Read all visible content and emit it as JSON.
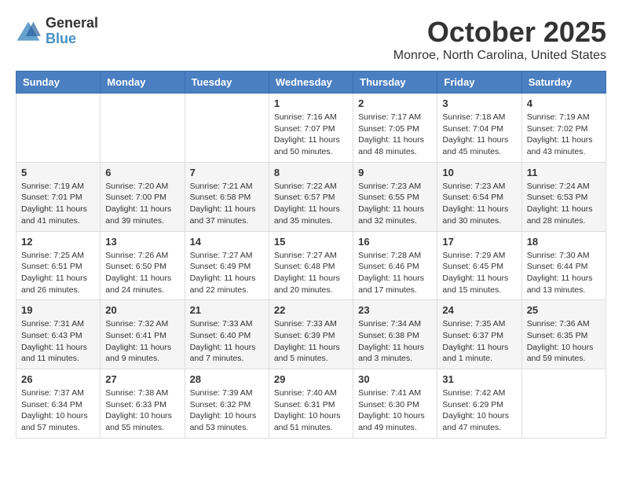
{
  "header": {
    "logo_general": "General",
    "logo_blue": "Blue",
    "month_title": "October 2025",
    "location": "Monroe, North Carolina, United States"
  },
  "days_of_week": [
    "Sunday",
    "Monday",
    "Tuesday",
    "Wednesday",
    "Thursday",
    "Friday",
    "Saturday"
  ],
  "weeks": [
    [
      {
        "day": "",
        "info": ""
      },
      {
        "day": "",
        "info": ""
      },
      {
        "day": "",
        "info": ""
      },
      {
        "day": "1",
        "info": "Sunrise: 7:16 AM\nSunset: 7:07 PM\nDaylight: 11 hours\nand 50 minutes."
      },
      {
        "day": "2",
        "info": "Sunrise: 7:17 AM\nSunset: 7:05 PM\nDaylight: 11 hours\nand 48 minutes."
      },
      {
        "day": "3",
        "info": "Sunrise: 7:18 AM\nSunset: 7:04 PM\nDaylight: 11 hours\nand 45 minutes."
      },
      {
        "day": "4",
        "info": "Sunrise: 7:19 AM\nSunset: 7:02 PM\nDaylight: 11 hours\nand 43 minutes."
      }
    ],
    [
      {
        "day": "5",
        "info": "Sunrise: 7:19 AM\nSunset: 7:01 PM\nDaylight: 11 hours\nand 41 minutes."
      },
      {
        "day": "6",
        "info": "Sunrise: 7:20 AM\nSunset: 7:00 PM\nDaylight: 11 hours\nand 39 minutes."
      },
      {
        "day": "7",
        "info": "Sunrise: 7:21 AM\nSunset: 6:58 PM\nDaylight: 11 hours\nand 37 minutes."
      },
      {
        "day": "8",
        "info": "Sunrise: 7:22 AM\nSunset: 6:57 PM\nDaylight: 11 hours\nand 35 minutes."
      },
      {
        "day": "9",
        "info": "Sunrise: 7:23 AM\nSunset: 6:55 PM\nDaylight: 11 hours\nand 32 minutes."
      },
      {
        "day": "10",
        "info": "Sunrise: 7:23 AM\nSunset: 6:54 PM\nDaylight: 11 hours\nand 30 minutes."
      },
      {
        "day": "11",
        "info": "Sunrise: 7:24 AM\nSunset: 6:53 PM\nDaylight: 11 hours\nand 28 minutes."
      }
    ],
    [
      {
        "day": "12",
        "info": "Sunrise: 7:25 AM\nSunset: 6:51 PM\nDaylight: 11 hours\nand 26 minutes."
      },
      {
        "day": "13",
        "info": "Sunrise: 7:26 AM\nSunset: 6:50 PM\nDaylight: 11 hours\nand 24 minutes."
      },
      {
        "day": "14",
        "info": "Sunrise: 7:27 AM\nSunset: 6:49 PM\nDaylight: 11 hours\nand 22 minutes."
      },
      {
        "day": "15",
        "info": "Sunrise: 7:27 AM\nSunset: 6:48 PM\nDaylight: 11 hours\nand 20 minutes."
      },
      {
        "day": "16",
        "info": "Sunrise: 7:28 AM\nSunset: 6:46 PM\nDaylight: 11 hours\nand 17 minutes."
      },
      {
        "day": "17",
        "info": "Sunrise: 7:29 AM\nSunset: 6:45 PM\nDaylight: 11 hours\nand 15 minutes."
      },
      {
        "day": "18",
        "info": "Sunrise: 7:30 AM\nSunset: 6:44 PM\nDaylight: 11 hours\nand 13 minutes."
      }
    ],
    [
      {
        "day": "19",
        "info": "Sunrise: 7:31 AM\nSunset: 6:43 PM\nDaylight: 11 hours\nand 11 minutes."
      },
      {
        "day": "20",
        "info": "Sunrise: 7:32 AM\nSunset: 6:41 PM\nDaylight: 11 hours\nand 9 minutes."
      },
      {
        "day": "21",
        "info": "Sunrise: 7:33 AM\nSunset: 6:40 PM\nDaylight: 11 hours\nand 7 minutes."
      },
      {
        "day": "22",
        "info": "Sunrise: 7:33 AM\nSunset: 6:39 PM\nDaylight: 11 hours\nand 5 minutes."
      },
      {
        "day": "23",
        "info": "Sunrise: 7:34 AM\nSunset: 6:38 PM\nDaylight: 11 hours\nand 3 minutes."
      },
      {
        "day": "24",
        "info": "Sunrise: 7:35 AM\nSunset: 6:37 PM\nDaylight: 11 hours\nand 1 minute."
      },
      {
        "day": "25",
        "info": "Sunrise: 7:36 AM\nSunset: 6:35 PM\nDaylight: 10 hours\nand 59 minutes."
      }
    ],
    [
      {
        "day": "26",
        "info": "Sunrise: 7:37 AM\nSunset: 6:34 PM\nDaylight: 10 hours\nand 57 minutes."
      },
      {
        "day": "27",
        "info": "Sunrise: 7:38 AM\nSunset: 6:33 PM\nDaylight: 10 hours\nand 55 minutes."
      },
      {
        "day": "28",
        "info": "Sunrise: 7:39 AM\nSunset: 6:32 PM\nDaylight: 10 hours\nand 53 minutes."
      },
      {
        "day": "29",
        "info": "Sunrise: 7:40 AM\nSunset: 6:31 PM\nDaylight: 10 hours\nand 51 minutes."
      },
      {
        "day": "30",
        "info": "Sunrise: 7:41 AM\nSunset: 6:30 PM\nDaylight: 10 hours\nand 49 minutes."
      },
      {
        "day": "31",
        "info": "Sunrise: 7:42 AM\nSunset: 6:29 PM\nDaylight: 10 hours\nand 47 minutes."
      },
      {
        "day": "",
        "info": ""
      }
    ]
  ]
}
